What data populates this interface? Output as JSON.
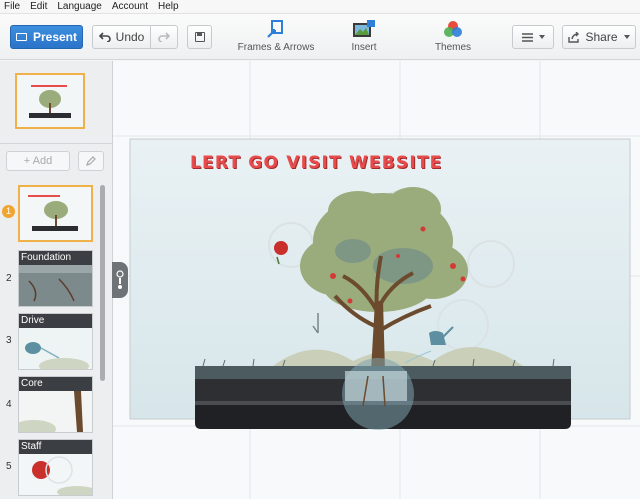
{
  "menu": {
    "items": [
      "File",
      "Edit",
      "Language",
      "Account",
      "Help"
    ]
  },
  "toolbar": {
    "present_label": "Present",
    "undo_label": "Undo",
    "frames_label": "Frames & Arrows",
    "insert_label": "Insert",
    "themes_label": "Themes",
    "share_label": "Share"
  },
  "sidebar": {
    "add_label": "+ Add",
    "slides": [
      {
        "number": "1",
        "label": ""
      },
      {
        "number": "2",
        "label": "Foundation"
      },
      {
        "number": "3",
        "label": "Drive"
      },
      {
        "number": "4",
        "label": "Core"
      },
      {
        "number": "5",
        "label": "Staff"
      }
    ]
  },
  "canvas": {
    "title": "LERT GO VISIT WEBSITE"
  },
  "colors": {
    "accent": "#2f7ed8",
    "selected": "#f0b04a",
    "title": "#e84b4b"
  }
}
